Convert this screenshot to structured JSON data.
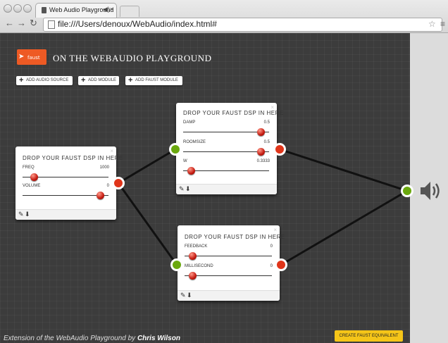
{
  "browser": {
    "tab_title": "Web Audio Playground",
    "tab_sound_icon": "speaker-icon",
    "tab_close": "×",
    "url": "file:///Users/denoux/WebAudio/index.html#"
  },
  "app": {
    "logo_text": "faust",
    "title": "ON THE WEBAUDIO PLAYGROUND"
  },
  "toolbar": {
    "add_audio_source": "ADD AUDIO SOURCE",
    "add_module": "ADD MODULE",
    "add_faust_module": "ADD FAUST MODULE"
  },
  "modules": {
    "left": {
      "title": "DROP YOUR FAUST DSP IN HERE",
      "params": [
        {
          "label": "FREQ",
          "value": "1000",
          "level": 0.1
        },
        {
          "label": "VOLUME",
          "value": "0",
          "level": 0.95
        }
      ]
    },
    "top": {
      "title": "DROP YOUR FAUST DSP IN HERE",
      "params": [
        {
          "label": "DAMP",
          "value": "0.5",
          "level": 0.95
        },
        {
          "label": "ROOMSIZE",
          "value": "0.5",
          "level": 0.95
        },
        {
          "label": "W",
          "value": "0.3333",
          "level": 0.05
        }
      ]
    },
    "bottom": {
      "title": "DROP YOUR FAUST DSP IN HERE",
      "params": [
        {
          "label": "FEEDBACK",
          "value": "0",
          "level": 0.05
        },
        {
          "label": "MILLISECOND",
          "value": "0",
          "level": 0.05
        }
      ]
    }
  },
  "footer": {
    "credit_prefix": "Extension of the WebAudio Playground by ",
    "credit_author": "Chris Wilson",
    "create_faust_button": "CREATE FAUST EQUIVALENT"
  },
  "colors": {
    "canvas_bg": "#3c3c3c",
    "input_connector": "#6aa80e",
    "output_connector": "#e0351a",
    "accent_button": "#f5c518",
    "logo": "#ee5a24"
  }
}
